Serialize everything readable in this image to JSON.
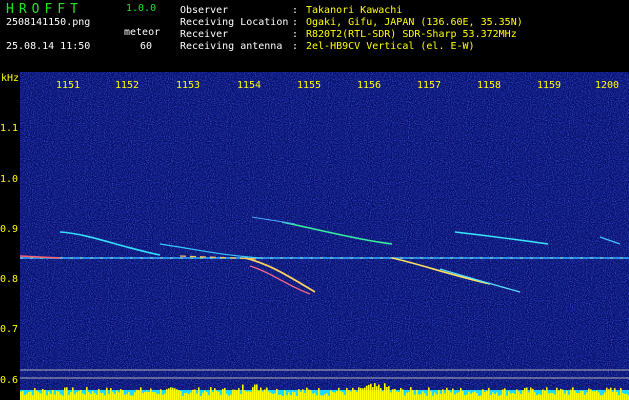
{
  "app": {
    "title": "HROFFT",
    "version": "1.0.0"
  },
  "file": {
    "name": "2508141150.png",
    "timestamp": "25.08.14 11:50"
  },
  "mode": {
    "label": "meteor",
    "value": "60"
  },
  "info": [
    {
      "label": "Observer",
      "value": "Takanori Kawachi"
    },
    {
      "label": "Receiving Location",
      "value": "Ogaki, Gifu, JAPAN (136.60E, 35.35N)"
    },
    {
      "label": "Receiver",
      "value": "R820T2(RTL-SDR) SDR-Sharp 53.372MHz"
    },
    {
      "label": "Receiving antenna",
      "value": "2el-HB9CV Vertical (el. E-W)"
    }
  ],
  "axes": {
    "y_unit": "kHz",
    "y_ticks": [
      "1.1",
      "1.0",
      "0.9",
      "0.8",
      "0.7",
      "0.6"
    ],
    "x_ticks": [
      "1151",
      "1152",
      "1153",
      "1154",
      "1155",
      "1156",
      "1157",
      "1158",
      "1159",
      "1200"
    ]
  },
  "colors": {
    "title": "#1ee81e",
    "accent": "#ffff00",
    "background": "#000000",
    "noise": "#0a1470"
  }
}
